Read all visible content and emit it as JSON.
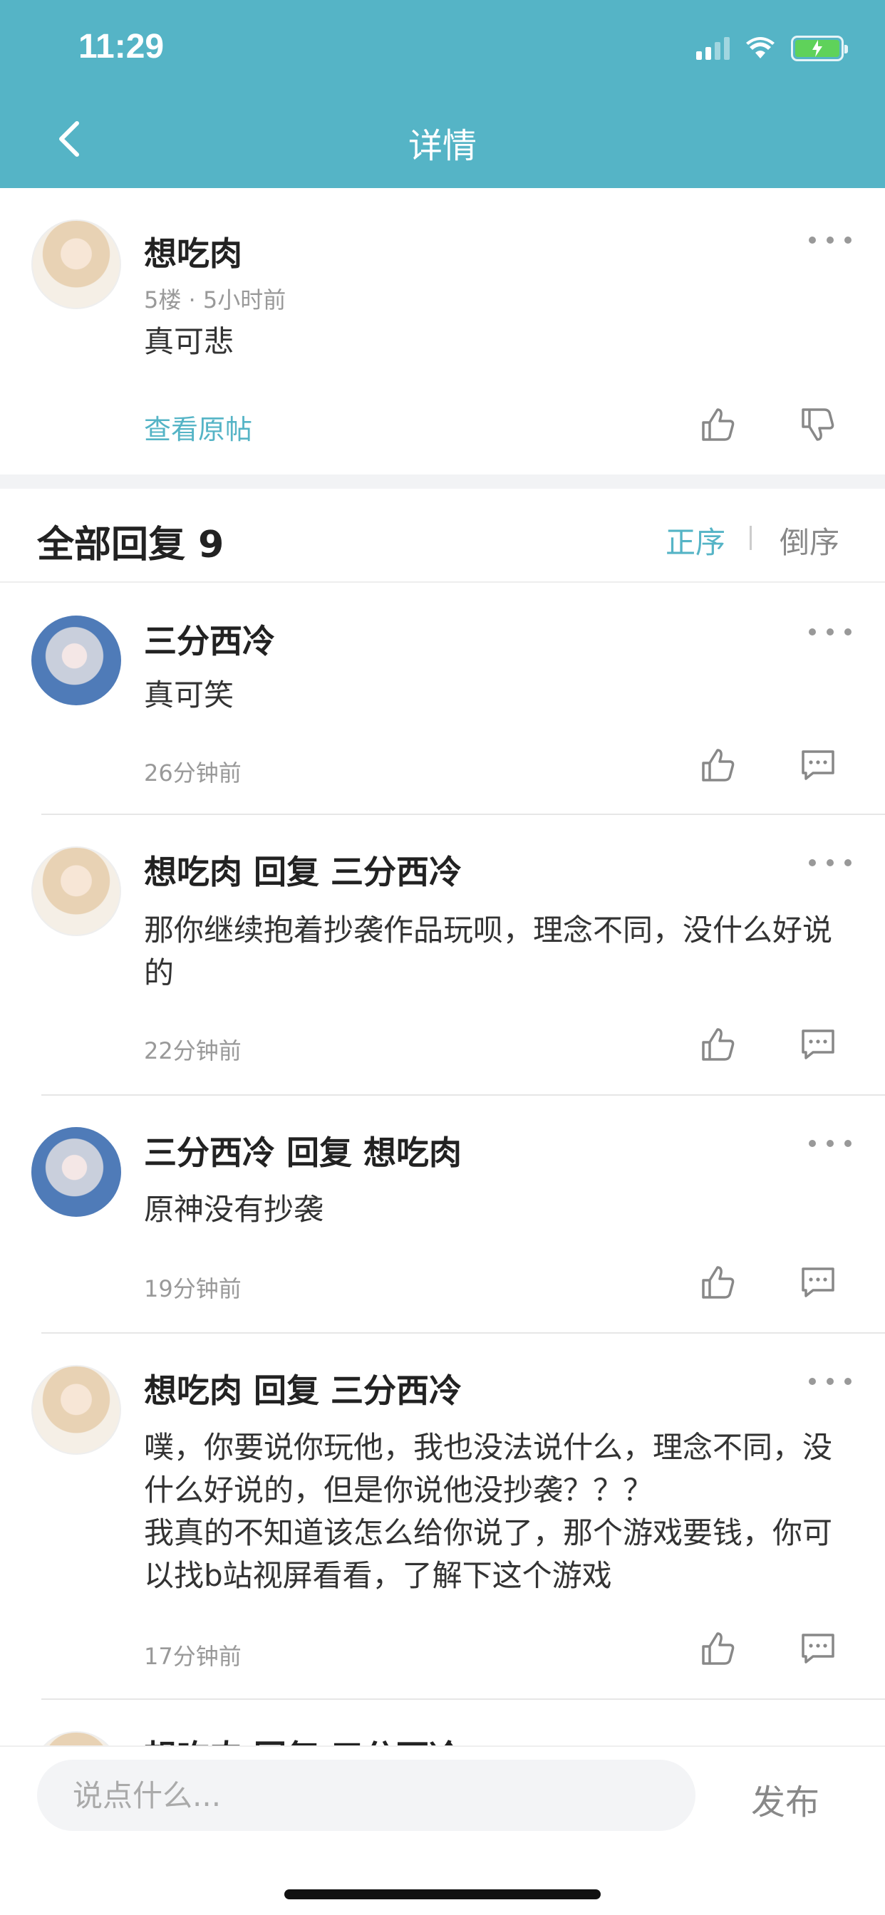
{
  "status_bar": {
    "time": "11:29"
  },
  "nav": {
    "title": "详情"
  },
  "post": {
    "username": "想吃肉",
    "meta": "5楼 · 5小时前",
    "content": "真可悲",
    "view_original": "查看原帖"
  },
  "replies_header": {
    "title": "全部回复 9",
    "sort_asc": "正序",
    "sort_desc": "倒序"
  },
  "replies": [
    {
      "username": "三分西冷",
      "content_lines": [
        "真可笑"
      ],
      "time": "26分钟前",
      "avatar": "silver"
    },
    {
      "username": "想吃肉 回复 三分西冷",
      "content_lines": [
        "那你继续抱着抄袭作品玩呗，理念不同，没什么好说",
        "的"
      ],
      "time": "22分钟前",
      "avatar": "blonde"
    },
    {
      "username": "三分西冷 回复 想吃肉",
      "content_lines": [
        "原神没有抄袭"
      ],
      "time": "19分钟前",
      "avatar": "silver"
    },
    {
      "username": "想吃肉 回复 三分西冷",
      "content_lines": [
        "噗，你要说你玩他，我也没法说什么，理念不同，没",
        "什么好说的，但是你说他没抄袭？？？",
        "我真的不知道该怎么给你说了，那个游戏要钱，你可",
        "以找b站视屏看看，了解下这个游戏"
      ],
      "time": "17分钟前",
      "avatar": "blonde"
    },
    {
      "username": "想吃肉 回复 三分西冷",
      "content_lines": [],
      "time": "",
      "avatar": "blonde"
    }
  ],
  "bottom_bar": {
    "input_placeholder": "说点什么...",
    "publish_label": "发布"
  },
  "colors": {
    "header_bg": "#55b4c6",
    "accent": "#55b4c6",
    "battery_fill": "#5fd25a"
  },
  "icons": [
    "back-icon",
    "more-icon",
    "thumbs-up-icon",
    "thumbs-down-icon",
    "comment-icon",
    "signal-icon",
    "wifi-icon",
    "battery-icon"
  ]
}
